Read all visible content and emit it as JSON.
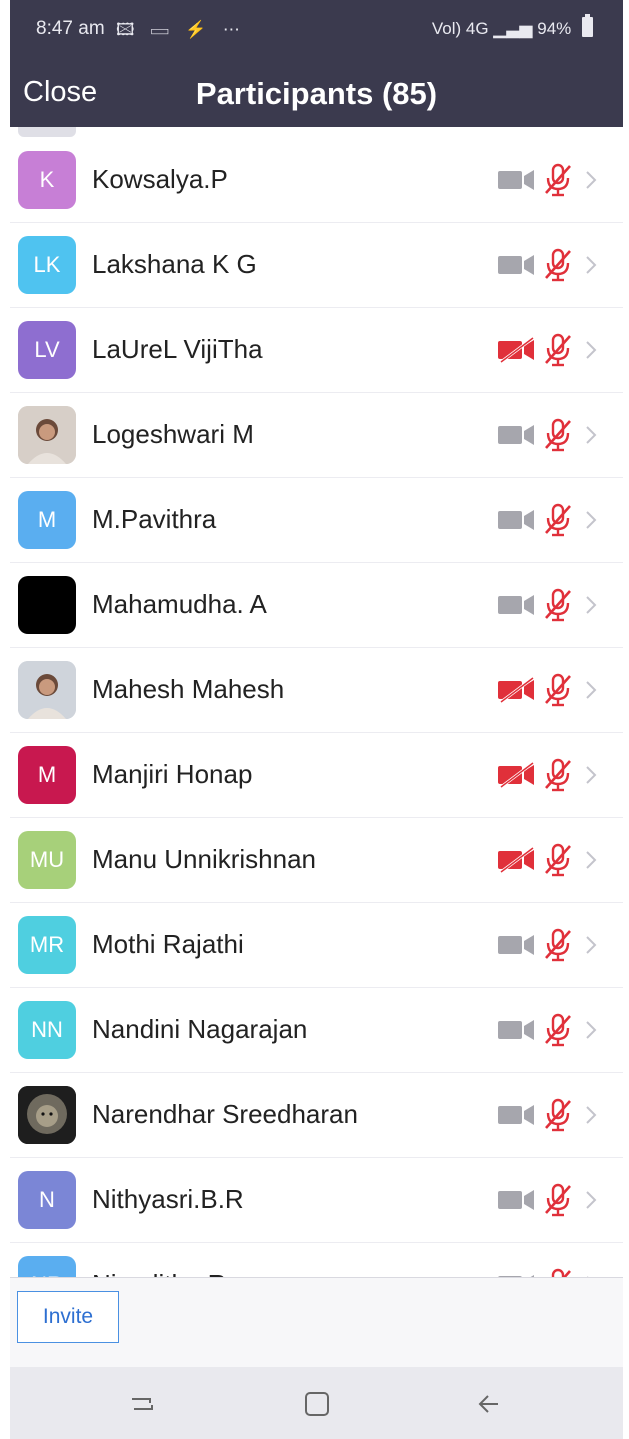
{
  "status": {
    "time": "8:47 am",
    "left_icons": "🖾 ▭ ⚡ ⋯",
    "network": "Vol) 4G",
    "battery": "94%"
  },
  "header": {
    "close_label": "Close",
    "title": "Participants (85)"
  },
  "colors": {
    "header_bg": "#3b3a4e",
    "muted_red": "#e0303a",
    "cam_gray": "#a6a6ad",
    "invite_blue": "#2d6fd1"
  },
  "participants": [
    {
      "initials": "K",
      "name": "Kowsalya.P",
      "avatar_color": "#c77fd6",
      "video_off": false
    },
    {
      "initials": "LK",
      "name": "Lakshana K G",
      "avatar_color": "#4fc3f0",
      "video_off": false
    },
    {
      "initials": "LV",
      "name": "LaUreL VijiTha",
      "avatar_color": "#8e6ed0",
      "video_off": true
    },
    {
      "initials": "",
      "name": "Logeshwari M",
      "avatar_color": "#d7cfc8",
      "video_off": false,
      "photo": "portrait-photo"
    },
    {
      "initials": "M",
      "name": "M.Pavithra",
      "avatar_color": "#5aaef0",
      "video_off": false
    },
    {
      "initials": "",
      "name": "Mahamudha. A",
      "avatar_color": "#000000",
      "video_off": false
    },
    {
      "initials": "",
      "name": "Mahesh Mahesh",
      "avatar_color": "#cfd4db",
      "video_off": true,
      "photo": "portrait-photo"
    },
    {
      "initials": "M",
      "name": "Manjiri Honap",
      "avatar_color": "#c8184f",
      "video_off": true
    },
    {
      "initials": "MU",
      "name": "Manu Unnikrishnan",
      "avatar_color": "#a7d07a",
      "video_off": true
    },
    {
      "initials": "MR",
      "name": "Mothi Rajathi",
      "avatar_color": "#4fcfe0",
      "video_off": false
    },
    {
      "initials": "NN",
      "name": "Nandini Nagarajan",
      "avatar_color": "#4fcfe0",
      "video_off": false
    },
    {
      "initials": "",
      "name": "Narendhar Sreedharan",
      "avatar_color": "#2b2b2b",
      "video_off": false,
      "photo": "lion-photo"
    },
    {
      "initials": "N",
      "name": "Nithyasri.B.R",
      "avatar_color": "#7b86d6",
      "video_off": false
    },
    {
      "initials": "NR",
      "name": "Niveditha R",
      "avatar_color": "#5aaef0",
      "video_off": false
    }
  ],
  "footer": {
    "invite_label": "Invite"
  },
  "navbar": {
    "items": [
      "recent-apps-icon",
      "home-icon",
      "back-icon"
    ]
  }
}
